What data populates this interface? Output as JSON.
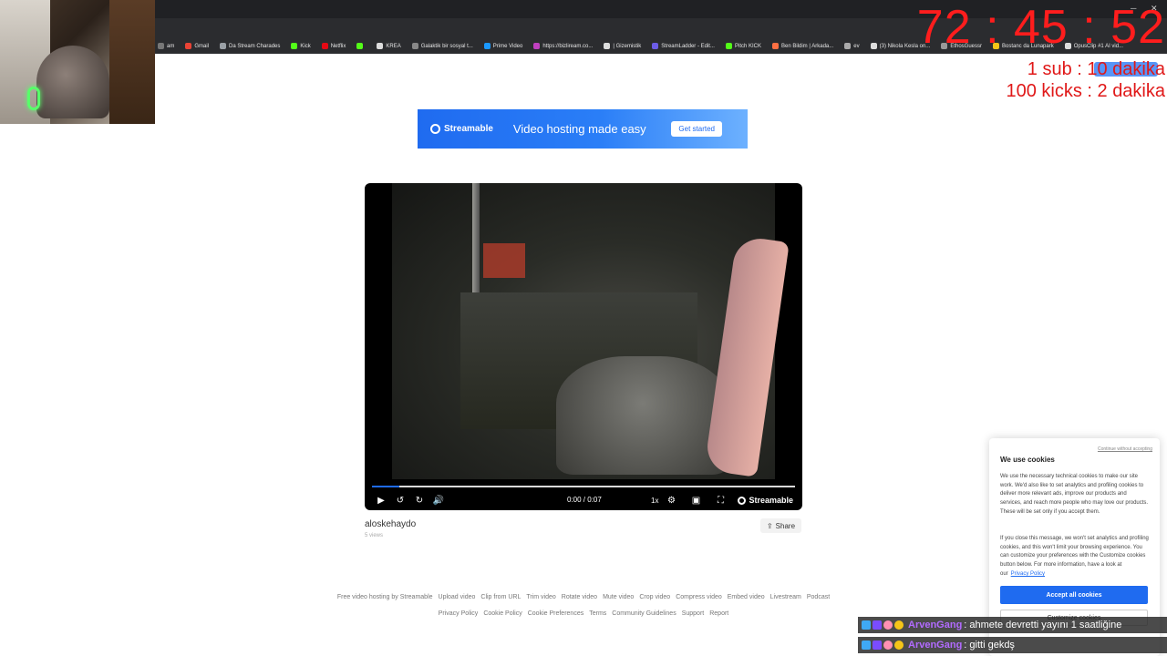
{
  "bookmarks": [
    {
      "label": "am",
      "color": "#777777"
    },
    {
      "label": "Gmail",
      "color": "#ea4335"
    },
    {
      "label": "Da Stream Charades",
      "color": "#9aa0a6"
    },
    {
      "label": "Kick",
      "color": "#53fc18"
    },
    {
      "label": "Netflix",
      "color": "#e50914"
    },
    {
      "label": "",
      "color": "#53fc18"
    },
    {
      "label": "KREA",
      "color": "#dddddd"
    },
    {
      "label": "Galaktik bir sosyal t...",
      "color": "#888888"
    },
    {
      "label": "Prime Video",
      "color": "#1a98ff"
    },
    {
      "label": "https://bizliream.co...",
      "color": "#c040c0"
    },
    {
      "label": "| Gizemistik",
      "color": "#dddddd"
    },
    {
      "label": "StreamLadder - Edit...",
      "color": "#6c5ce7"
    },
    {
      "label": "Pitch KICK",
      "color": "#53fc18"
    },
    {
      "label": "Ben Bildim | Arkada...",
      "color": "#ff7043"
    },
    {
      "label": "ev",
      "color": "#aaaaaa"
    },
    {
      "label": "(3) Nikola Kesla on...",
      "color": "#dddddd"
    },
    {
      "label": "EthosGuessr",
      "color": "#999999"
    },
    {
      "label": "Bostanc da Lunapark",
      "color": "#f5c518"
    },
    {
      "label": "OpusClip #1 AI vid...",
      "color": "#dddddd"
    }
  ],
  "overlay": {
    "timer": "72 : 45 : 52",
    "goal1": "1 sub : 10 dakika",
    "goal2": "100 kicks : 2 dakika"
  },
  "banner": {
    "brand": "Streamable",
    "tagline": "Video hosting made easy",
    "cta": "Get started"
  },
  "player": {
    "time": "0:00 / 0:07",
    "speed": "1x",
    "brand": "Streamable",
    "progress": 0
  },
  "video": {
    "title": "aloskehaydo",
    "views": "5 views",
    "share": "Share"
  },
  "footer": {
    "row1": [
      "Free video hosting by Streamable",
      "Upload video",
      "Clip from URL",
      "Trim video",
      "Rotate video",
      "Mute video",
      "Crop video",
      "Compress video",
      "Embed video",
      "Livestream",
      "Podcast"
    ],
    "row2": [
      "Privacy Policy",
      "Cookie Policy",
      "Cookie Preferences",
      "Terms",
      "Community Guidelines",
      "Support",
      "Report"
    ]
  },
  "cookie": {
    "dismiss": "Continue without accepting",
    "title": "We use cookies",
    "para1": "We use the necessary technical cookies to make our site work. We'd also like to set analytics and profiling cookies to deliver more relevant ads, improve our products and services, and reach more people who may love our products. These will be set only if you accept them.",
    "para2": "If you close this message, we won't set analytics and profiling cookies, and this won't limit your browsing experience. You can customize your preferences with the Customize cookies button below. For more information, have a look at our",
    "link": "Privacy Policy",
    "accept": "Accept all cookies",
    "customize": "Customize cookies"
  },
  "chat": [
    {
      "user": "ArvenGang",
      "message": ": ahmete devretti yayını 1 saatliğine"
    },
    {
      "user": "ArvenGang",
      "message": ": gitti gekdş"
    }
  ]
}
